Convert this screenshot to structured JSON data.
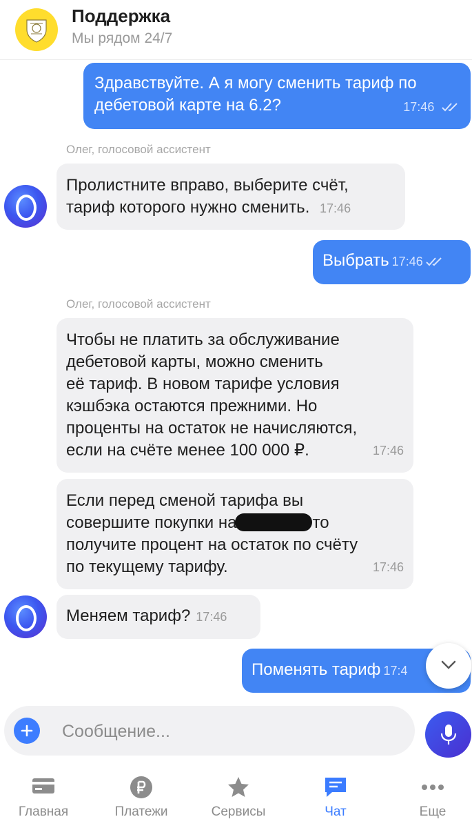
{
  "header": {
    "title": "Поддержка",
    "subtitle": "Мы рядом 24/7"
  },
  "chat": {
    "messages": [
      {
        "type": "out",
        "line1": "Здравствуйте. А я могу сменить тариф по",
        "line2": "дебетовой карте на 6.2?",
        "time": "17:46"
      },
      {
        "type": "in",
        "sender": "Олег, голосовой ассистент",
        "line1": "Пролистните вправо, выберите счёт,",
        "line2": "тариф которого нужно сменить.",
        "time": "17:46"
      },
      {
        "type": "out",
        "text": "Выбрать",
        "time": "17:46"
      },
      {
        "type": "in",
        "sender": "Олег, голосовой ассистент",
        "lines": [
          "Чтобы не платить за обслуживание",
          "дебетовой карты, можно сменить",
          "её тариф. В новом тарифе условия",
          "кэшбэка остаются прежними. Но",
          "проценты на остаток не начисляются,",
          "если на счёте менее 100 000 ₽."
        ],
        "time": "17:46"
      },
      {
        "type": "in",
        "line1": "Если перед сменой тарифа вы",
        "line2a": "совершите покупки на",
        "line2b": "то",
        "line3": "получите процент на остаток по счёту",
        "line4": "по текущему тарифу.",
        "time": "17:46"
      },
      {
        "type": "in",
        "text": "Меняем тариф?",
        "time": "17:46"
      },
      {
        "type": "out",
        "text": "Поменять тариф",
        "time": "17:4"
      }
    ]
  },
  "input": {
    "placeholder": "Сообщение..."
  },
  "nav": {
    "items": [
      {
        "label": "Главная",
        "icon": "card-icon"
      },
      {
        "label": "Платежи",
        "icon": "ruble-icon"
      },
      {
        "label": "Сервисы",
        "icon": "star-icon"
      },
      {
        "label": "Чат",
        "icon": "chat-icon",
        "active": true
      },
      {
        "label": "Еще",
        "icon": "more-icon"
      }
    ]
  },
  "colors": {
    "accent": "#4285f4",
    "brand_yellow": "#ffdd2d",
    "incoming_bubble": "#f0f0f2",
    "active_nav": "#3b7cff"
  }
}
